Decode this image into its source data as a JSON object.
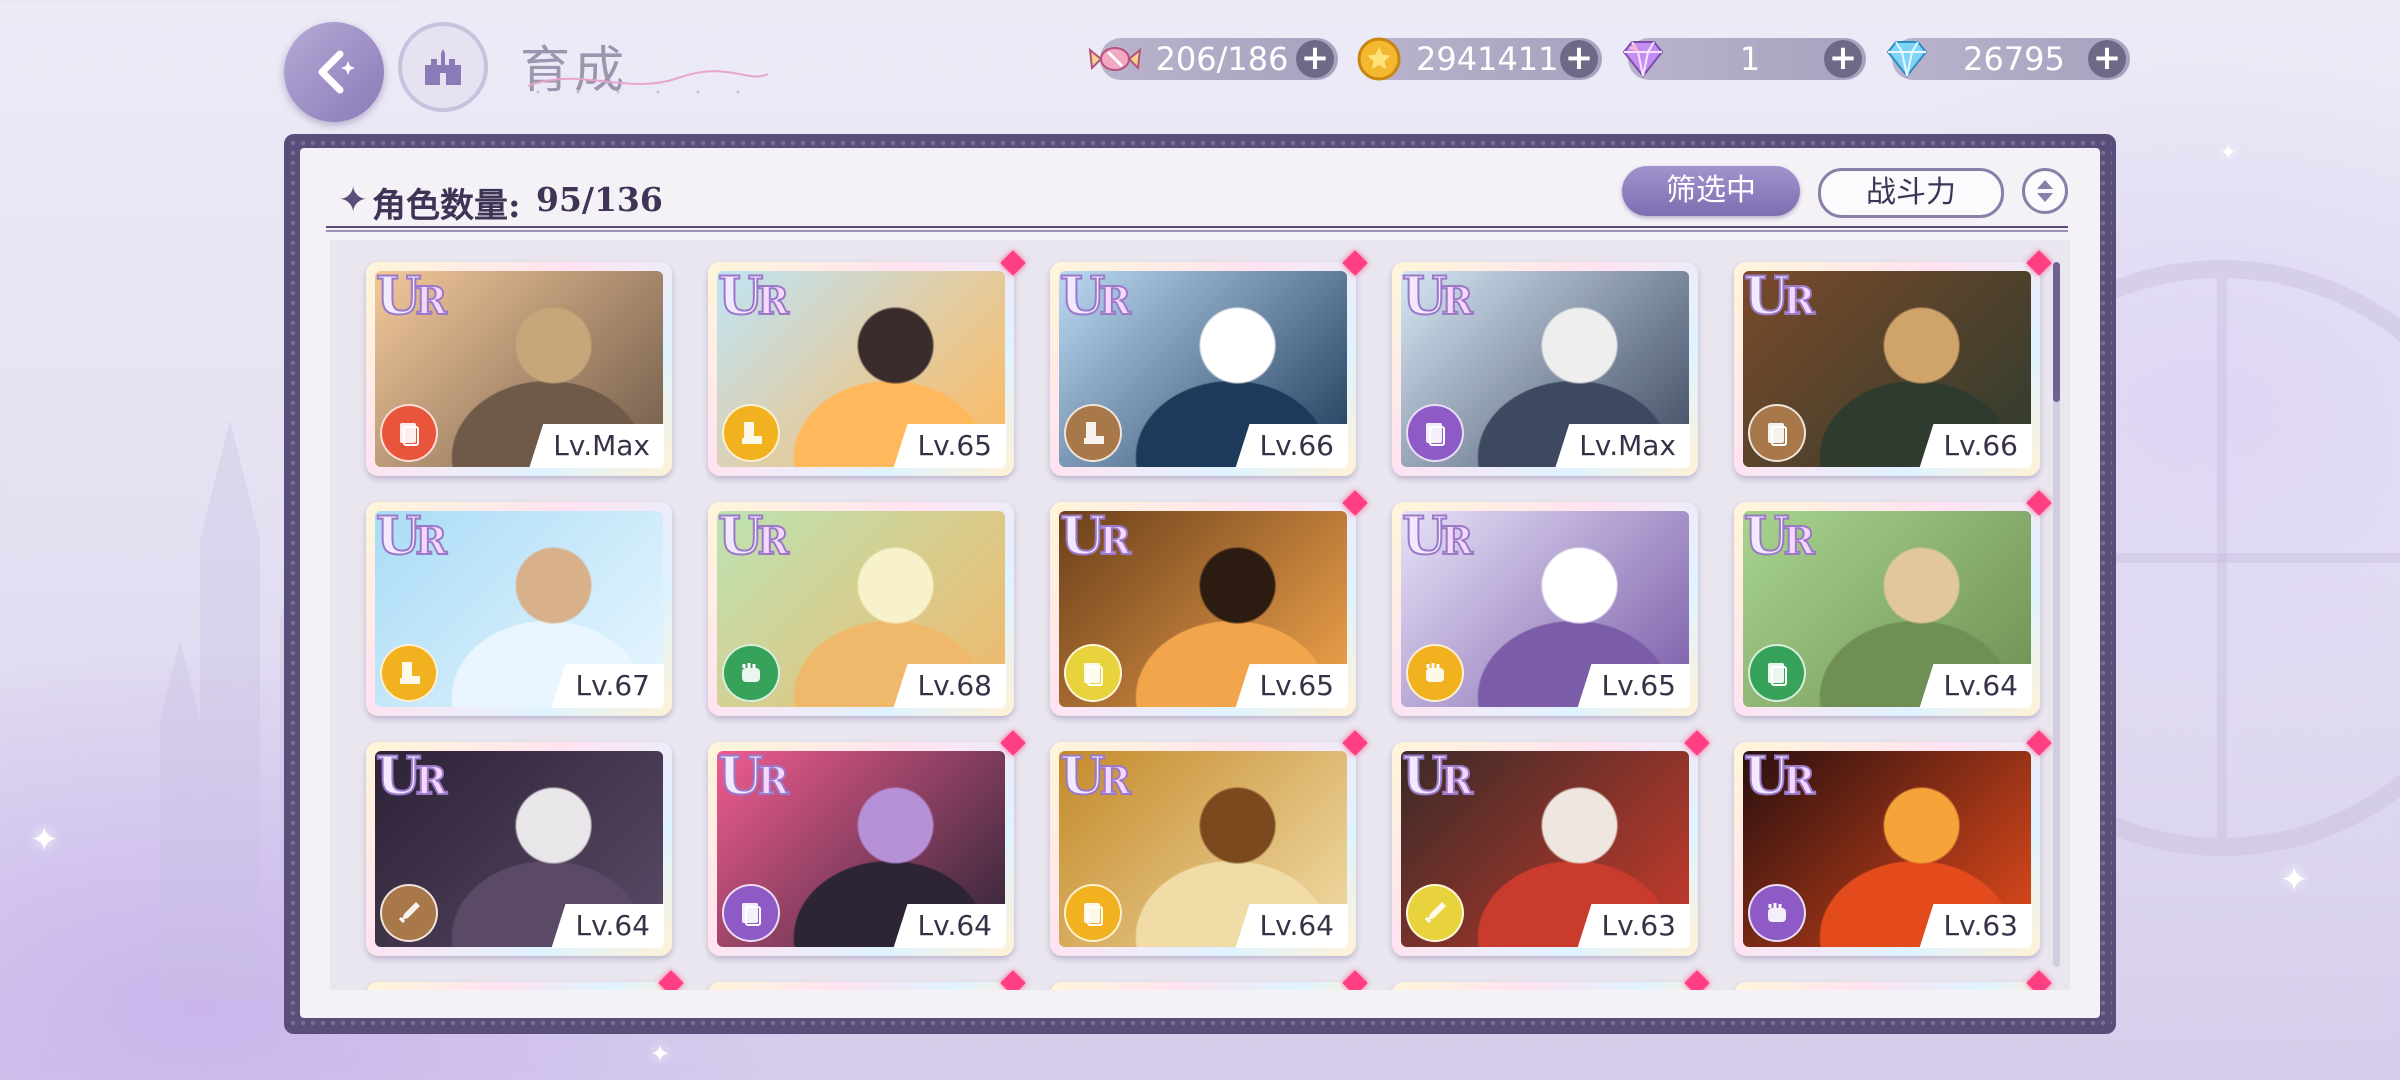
{
  "header": {
    "title": "育成",
    "resources": [
      {
        "name": "candy",
        "value": "206/186",
        "icon": "candy-icon",
        "color": "#f2a7c3"
      },
      {
        "name": "gold",
        "value": "2941411",
        "icon": "gold-coin-icon",
        "color": "#f4b730"
      },
      {
        "name": "rainbow-gem",
        "value": "1",
        "icon": "rainbow-diamond-icon",
        "color": "#c38ef2"
      },
      {
        "name": "diamond",
        "value": "26795",
        "icon": "blue-diamond-icon",
        "color": "#7fd3f6"
      }
    ],
    "plus_label": "+"
  },
  "panel": {
    "count_label": "角色数量:",
    "count_value": "95/136",
    "filter_label": "筛选中",
    "sort_label": "战斗力"
  },
  "cards": [
    {
      "rarity": "UR",
      "level": "Lv.Max",
      "attr_color": "#e8553a",
      "attr_icon": "card-attribute-icon",
      "new": false,
      "palette": [
        "#f3c89a",
        "#6f5a4a",
        "#c7a77a"
      ]
    },
    {
      "rarity": "UR",
      "level": "Lv.65",
      "attr_color": "#f2b21f",
      "attr_icon": "boot-attribute-icon",
      "new": true,
      "palette": [
        "#bfe4f5",
        "#ffb85c",
        "#3a2c2c"
      ]
    },
    {
      "rarity": "UR",
      "level": "Lv.66",
      "attr_color": "#a8774a",
      "attr_icon": "boot-attribute-icon",
      "new": true,
      "palette": [
        "#bcd9f2",
        "#1e3a5a",
        "#ffffff"
      ]
    },
    {
      "rarity": "UR",
      "level": "Lv.Max",
      "attr_color": "#8e5bc6",
      "attr_icon": "card-attribute-icon",
      "new": false,
      "palette": [
        "#d6e6f4",
        "#3d4960",
        "#eeeeee"
      ]
    },
    {
      "rarity": "UR",
      "level": "Lv.66",
      "attr_color": "#a8774a",
      "attr_icon": "card-attribute-icon",
      "new": true,
      "palette": [
        "#7a4a2a",
        "#2f3b2e",
        "#d0a36b"
      ]
    },
    {
      "rarity": "UR",
      "level": "Lv.67",
      "attr_color": "#f2b21f",
      "attr_icon": "boot-attribute-icon",
      "new": false,
      "palette": [
        "#a9dcf5",
        "#e9f6ff",
        "#d8b08a"
      ]
    },
    {
      "rarity": "UR",
      "level": "Lv.68",
      "attr_color": "#37a35a",
      "attr_icon": "fist-attribute-icon",
      "new": false,
      "palette": [
        "#bde3b3",
        "#f0b86a",
        "#f7f2c9"
      ]
    },
    {
      "rarity": "UR",
      "level": "Lv.65",
      "attr_color": "#e9d33d",
      "attr_icon": "card-attribute-icon",
      "new": true,
      "palette": [
        "#6b3f1b",
        "#f3a54c",
        "#2b1b10"
      ]
    },
    {
      "rarity": "UR",
      "level": "Lv.65",
      "attr_color": "#f2b21f",
      "attr_icon": "fist-attribute-icon",
      "new": false,
      "palette": [
        "#e6e1f7",
        "#7a5ca8",
        "#ffffff"
      ]
    },
    {
      "rarity": "UR",
      "level": "Lv.64",
      "attr_color": "#37a35a",
      "attr_icon": "card-attribute-icon",
      "new": true,
      "palette": [
        "#a8d48f",
        "#6f8f54",
        "#e2c79b"
      ]
    },
    {
      "rarity": "UR",
      "level": "Lv.64",
      "attr_color": "#a8774a",
      "attr_icon": "sword-attribute-icon",
      "new": false,
      "palette": [
        "#2c2236",
        "#5a4a66",
        "#e9e6ea"
      ]
    },
    {
      "rarity": "UR",
      "level": "Lv.64",
      "attr_color": "#8e5bc6",
      "attr_icon": "card-attribute-icon",
      "new": true,
      "palette": [
        "#f05b8f",
        "#2d2536",
        "#b691d8"
      ]
    },
    {
      "rarity": "UR",
      "level": "Lv.64",
      "attr_color": "#f2b21f",
      "attr_icon": "card-attribute-icon",
      "new": true,
      "palette": [
        "#c48a2a",
        "#f1dca8",
        "#7a4a1e"
      ]
    },
    {
      "rarity": "UR",
      "level": "Lv.63",
      "attr_color": "#e9d33d",
      "attr_icon": "sword-attribute-icon",
      "new": true,
      "palette": [
        "#3a2a28",
        "#c93b2c",
        "#efe7df"
      ]
    },
    {
      "rarity": "UR",
      "level": "Lv.63",
      "attr_color": "#8e5bc6",
      "attr_icon": "fist-attribute-icon",
      "new": true,
      "palette": [
        "#2a0f0f",
        "#e34b1c",
        "#f6a43a"
      ]
    }
  ]
}
